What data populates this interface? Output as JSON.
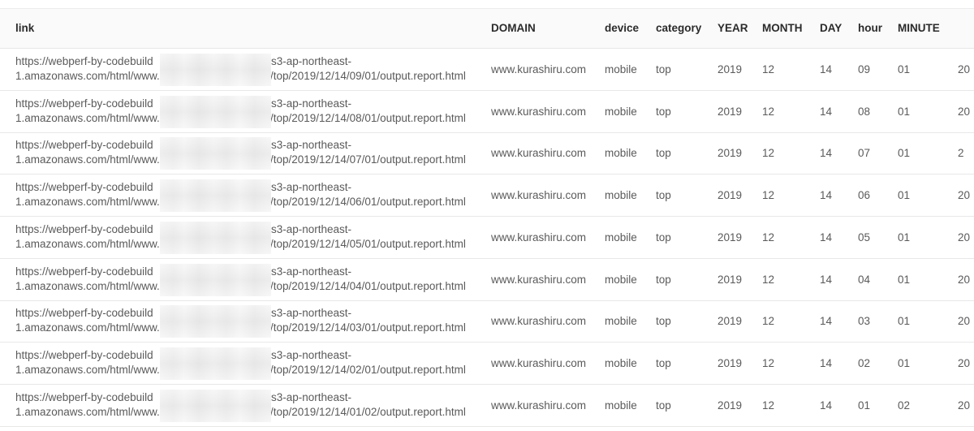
{
  "columns": {
    "link": "link",
    "domain": "DOMAIN",
    "device": "device",
    "category": "category",
    "year": "YEAR",
    "month": "MONTH",
    "day": "DAY",
    "hour": "hour",
    "minute": "MINUTE"
  },
  "rows": [
    {
      "link_l1a": "https://webperf-by-codebuild",
      "link_l1b": "s3-ap-northeast-",
      "link_l2a": "1.amazonaws.com/html/www.",
      "link_l2b": "/top/2019/12/14/09/01/output.report.html",
      "domain": "www.kurashiru.com",
      "device": "mobile",
      "category": "top",
      "year": "2019",
      "month": "12",
      "day": "14",
      "hour": "09",
      "minute": "01",
      "extra": "20"
    },
    {
      "link_l1a": "https://webperf-by-codebuild",
      "link_l1b": "s3-ap-northeast-",
      "link_l2a": "1.amazonaws.com/html/www.",
      "link_l2b": "/top/2019/12/14/08/01/output.report.html",
      "domain": "www.kurashiru.com",
      "device": "mobile",
      "category": "top",
      "year": "2019",
      "month": "12",
      "day": "14",
      "hour": "08",
      "minute": "01",
      "extra": "20"
    },
    {
      "link_l1a": "https://webperf-by-codebuild",
      "link_l1b": "s3-ap-northeast-",
      "link_l2a": "1.amazonaws.com/html/www.",
      "link_l2b": "/top/2019/12/14/07/01/output.report.html",
      "domain": "www.kurashiru.com",
      "device": "mobile",
      "category": "top",
      "year": "2019",
      "month": "12",
      "day": "14",
      "hour": "07",
      "minute": "01",
      "extra": "2"
    },
    {
      "link_l1a": "https://webperf-by-codebuild",
      "link_l1b": "s3-ap-northeast-",
      "link_l2a": "1.amazonaws.com/html/www.",
      "link_l2b": "/top/2019/12/14/06/01/output.report.html",
      "domain": "www.kurashiru.com",
      "device": "mobile",
      "category": "top",
      "year": "2019",
      "month": "12",
      "day": "14",
      "hour": "06",
      "minute": "01",
      "extra": "20"
    },
    {
      "link_l1a": "https://webperf-by-codebuild",
      "link_l1b": "s3-ap-northeast-",
      "link_l2a": "1.amazonaws.com/html/www.",
      "link_l2b": "/top/2019/12/14/05/01/output.report.html",
      "domain": "www.kurashiru.com",
      "device": "mobile",
      "category": "top",
      "year": "2019",
      "month": "12",
      "day": "14",
      "hour": "05",
      "minute": "01",
      "extra": "20"
    },
    {
      "link_l1a": "https://webperf-by-codebuild",
      "link_l1b": "s3-ap-northeast-",
      "link_l2a": "1.amazonaws.com/html/www.",
      "link_l2b": "/top/2019/12/14/04/01/output.report.html",
      "domain": "www.kurashiru.com",
      "device": "mobile",
      "category": "top",
      "year": "2019",
      "month": "12",
      "day": "14",
      "hour": "04",
      "minute": "01",
      "extra": "20"
    },
    {
      "link_l1a": "https://webperf-by-codebuild",
      "link_l1b": "s3-ap-northeast-",
      "link_l2a": "1.amazonaws.com/html/www.",
      "link_l2b": "/top/2019/12/14/03/01/output.report.html",
      "domain": "www.kurashiru.com",
      "device": "mobile",
      "category": "top",
      "year": "2019",
      "month": "12",
      "day": "14",
      "hour": "03",
      "minute": "01",
      "extra": "20"
    },
    {
      "link_l1a": "https://webperf-by-codebuild",
      "link_l1b": "s3-ap-northeast-",
      "link_l2a": "1.amazonaws.com/html/www.",
      "link_l2b": "/top/2019/12/14/02/01/output.report.html",
      "domain": "www.kurashiru.com",
      "device": "mobile",
      "category": "top",
      "year": "2019",
      "month": "12",
      "day": "14",
      "hour": "02",
      "minute": "01",
      "extra": "20"
    },
    {
      "link_l1a": "https://webperf-by-codebuild",
      "link_l1b": "s3-ap-northeast-",
      "link_l2a": "1.amazonaws.com/html/www.",
      "link_l2b": "/top/2019/12/14/01/02/output.report.html",
      "domain": "www.kurashiru.com",
      "device": "mobile",
      "category": "top",
      "year": "2019",
      "month": "12",
      "day": "14",
      "hour": "01",
      "minute": "02",
      "extra": "20"
    }
  ]
}
